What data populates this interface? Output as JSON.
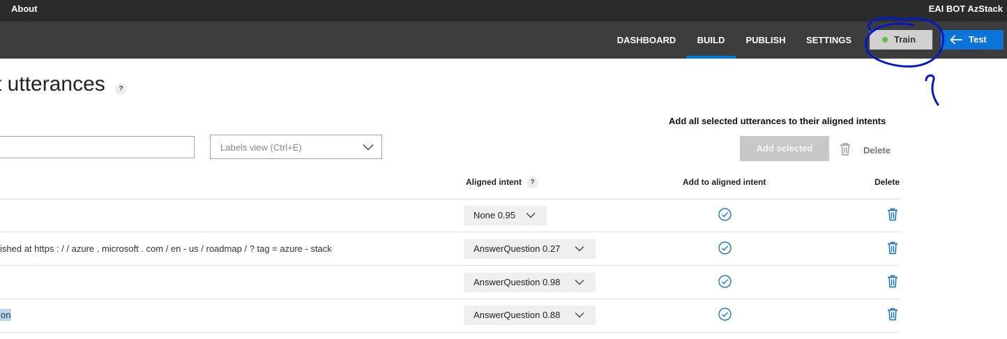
{
  "topbar": {
    "about": "About",
    "app_name": "EAI BOT AzStack"
  },
  "nav": {
    "items": [
      {
        "label": "DASHBOARD",
        "active": false
      },
      {
        "label": "BUILD",
        "active": true
      },
      {
        "label": "PUBLISH",
        "active": false
      },
      {
        "label": "SETTINGS",
        "active": false
      }
    ],
    "train_label": "Train",
    "train_status_color": "#5ec13b",
    "test_label": "Test",
    "accent_color": "#0078d4"
  },
  "page": {
    "title": "t utterances",
    "help": "?",
    "add_all_label": "Add all selected utterances to their aligned intents",
    "search_value": "",
    "labels_view_placeholder": "Labels view (Ctrl+E)",
    "add_selected_label": "Add selected",
    "delete_label": "Delete"
  },
  "table": {
    "headers": {
      "aligned_intent": "Aligned intent",
      "help": "?",
      "add_to_aligned": "Add to aligned intent",
      "delete": "Delete"
    },
    "rows": [
      {
        "text": "",
        "intent": "None 0.95",
        "highlight": false
      },
      {
        "text": "ished at https : / / azure . microsoft . com / en - us / roadmap / ? tag = azure - stack",
        "intent": "AnswerQuestion 0.27",
        "highlight": false
      },
      {
        "text": "",
        "intent": "AnswerQuestion 0.98",
        "highlight": false
      },
      {
        "text": "on",
        "intent": "AnswerQuestion 0.88",
        "highlight": true
      }
    ]
  },
  "icons": {
    "check": "check-circle-icon",
    "trash": "trash-icon",
    "arrow": "arrow-left-icon",
    "chevron": "chevron-down-icon"
  }
}
